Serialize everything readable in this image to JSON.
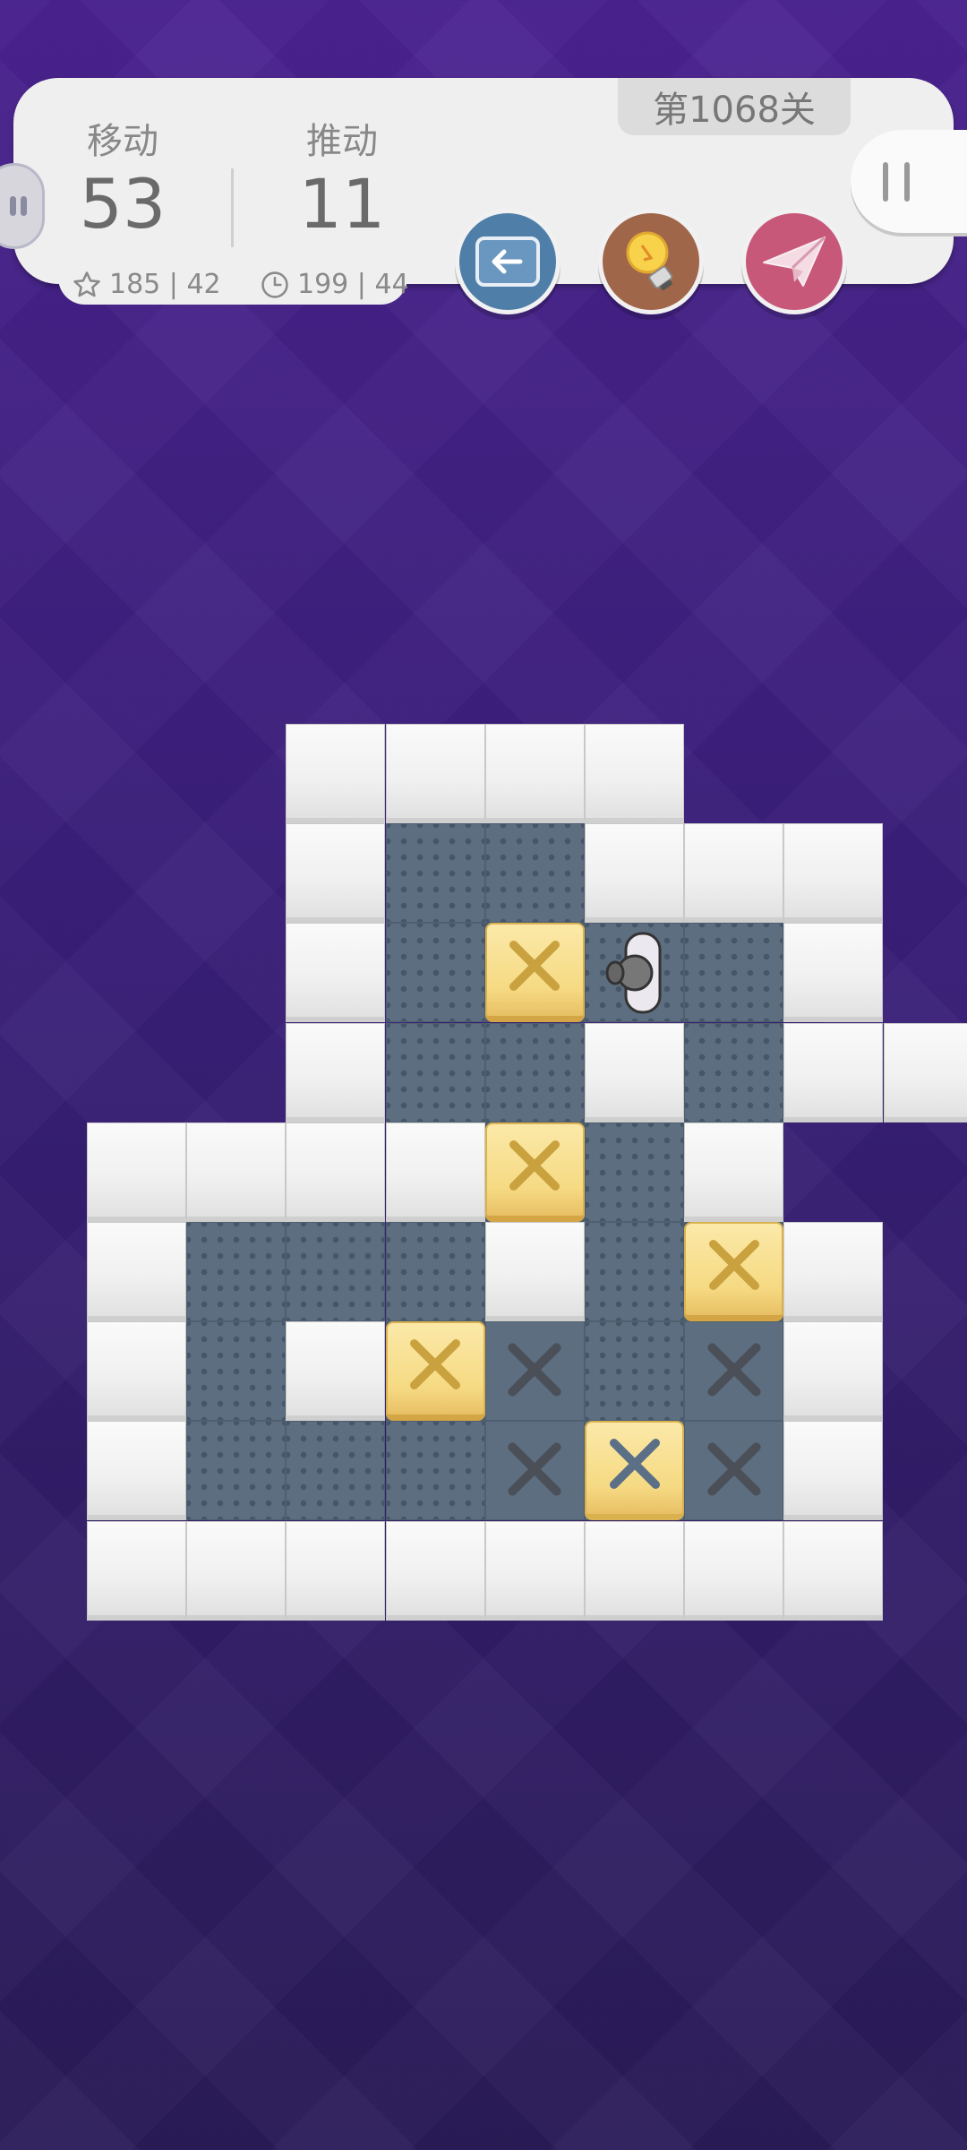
{
  "hud": {
    "level_label": "第1068关",
    "moves_label": "移动",
    "moves_value": "53",
    "pushes_label": "推动",
    "pushes_value": "11",
    "best_moves": "185 | 42",
    "best_time": "199 | 44"
  },
  "buttons": {
    "undo_icon": "back-arrow-icon",
    "hint_icon": "lightbulb-icon",
    "share_icon": "paper-plane-icon",
    "pause_icon": "pause-icon"
  },
  "colors": {
    "background": "#3a1f7a",
    "wall": "#f0f0f0",
    "floor": "#5d6e80",
    "box": "#f6da83",
    "undo_button": "#4f7fa8",
    "hint_button": "#a0664a",
    "share_button": "#c8587a"
  },
  "board": {
    "rows": [
      "  ####  ",
      "  #..###",
      "  #.$@.#",
      "  #..#.##",
      "####$.#",
      "#...#.$#",
      "#.#$X.X#",
      "#...X*X#",
      "########"
    ],
    "legend": {
      "#": "wall",
      ".": "floor",
      "$": "box",
      "@": "player",
      "X": "goal",
      "*": "box-on-goal"
    }
  }
}
